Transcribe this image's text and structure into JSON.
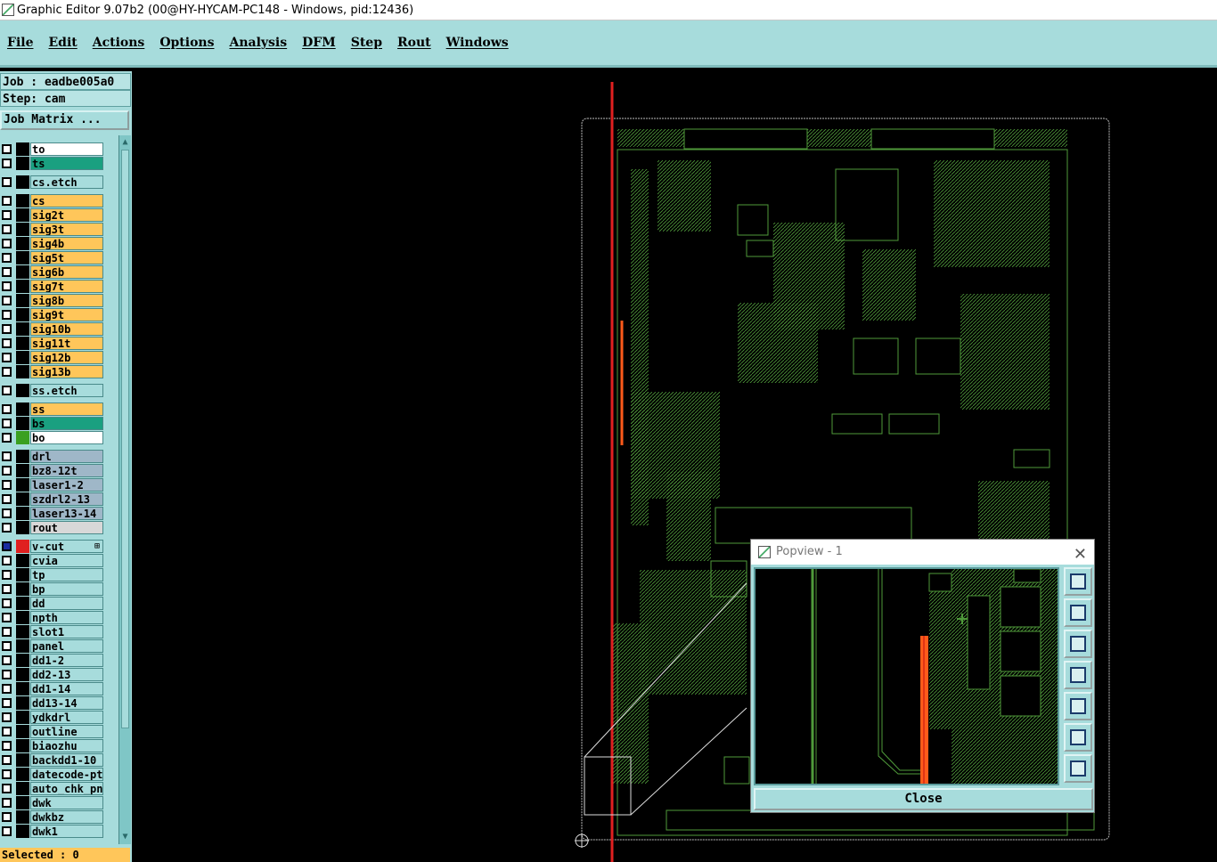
{
  "window": {
    "title": "Graphic Editor 9.07b2 (00@HY-HYCAM-PC148 - Windows, pid:12436)"
  },
  "menu": [
    "File",
    "Edit",
    "Actions",
    "Options",
    "Analysis",
    "DFM",
    "Step",
    "Rout",
    "Windows"
  ],
  "job": {
    "label": "Job : eadbe005a0",
    "step": "Step: cam",
    "matrix_button": "Job Matrix ..."
  },
  "layers": [
    {
      "name": "to",
      "color": "#ffffff",
      "sw": "#000000"
    },
    {
      "name": "ts",
      "color": "#1aa080",
      "sw": "#000000"
    },
    {
      "name": "cs.etch",
      "color": "#a7dcdc",
      "sw": "#000000",
      "gap": true
    },
    {
      "name": "cs",
      "color": "#ffc65a",
      "sw": "#000000",
      "gap": true
    },
    {
      "name": "sig2t",
      "color": "#ffc65a",
      "sw": "#000000"
    },
    {
      "name": "sig3t",
      "color": "#ffc65a",
      "sw": "#000000"
    },
    {
      "name": "sig4b",
      "color": "#ffc65a",
      "sw": "#000000"
    },
    {
      "name": "sig5t",
      "color": "#ffc65a",
      "sw": "#000000"
    },
    {
      "name": "sig6b",
      "color": "#ffc65a",
      "sw": "#000000"
    },
    {
      "name": "sig7t",
      "color": "#ffc65a",
      "sw": "#000000"
    },
    {
      "name": "sig8b",
      "color": "#ffc65a",
      "sw": "#000000"
    },
    {
      "name": "sig9t",
      "color": "#ffc65a",
      "sw": "#000000"
    },
    {
      "name": "sig10b",
      "color": "#ffc65a",
      "sw": "#000000"
    },
    {
      "name": "sig11t",
      "color": "#ffc65a",
      "sw": "#000000"
    },
    {
      "name": "sig12b",
      "color": "#ffc65a",
      "sw": "#000000"
    },
    {
      "name": "sig13b",
      "color": "#ffc65a",
      "sw": "#000000"
    },
    {
      "name": "ss.etch",
      "color": "#a7dcdc",
      "sw": "#000000",
      "gap": true
    },
    {
      "name": "ss",
      "color": "#ffc65a",
      "sw": "#000000",
      "gap": true
    },
    {
      "name": "bs",
      "color": "#1aa080",
      "sw": "#000000"
    },
    {
      "name": "bo",
      "color": "#ffffff",
      "sw": "#3aa020"
    },
    {
      "name": "drl",
      "color": "#9fb7c8",
      "sw": "#000000",
      "gap": true
    },
    {
      "name": "bz8-12t",
      "color": "#9fb7c8",
      "sw": "#000000"
    },
    {
      "name": "laser1-2",
      "color": "#9fb7c8",
      "sw": "#000000"
    },
    {
      "name": "szdrl2-13",
      "color": "#9fb7c8",
      "sw": "#000000"
    },
    {
      "name": "laser13-14",
      "color": "#9fb7c8",
      "sw": "#000000"
    },
    {
      "name": "rout",
      "color": "#d8d8d8",
      "sw": "#000000"
    },
    {
      "name": "v-cut",
      "color": "#a7dcdc",
      "sw": "#e02020",
      "cb": "#1a2aa0",
      "gap": true,
      "mark": "⊞"
    },
    {
      "name": "cvia",
      "color": "#a7dcdc",
      "sw": "#000000"
    },
    {
      "name": "tp",
      "color": "#a7dcdc",
      "sw": "#000000"
    },
    {
      "name": "bp",
      "color": "#a7dcdc",
      "sw": "#000000"
    },
    {
      "name": "dd",
      "color": "#a7dcdc",
      "sw": "#000000"
    },
    {
      "name": "npth",
      "color": "#a7dcdc",
      "sw": "#000000"
    },
    {
      "name": "slot1",
      "color": "#a7dcdc",
      "sw": "#000000"
    },
    {
      "name": "panel",
      "color": "#a7dcdc",
      "sw": "#000000"
    },
    {
      "name": "dd1-2",
      "color": "#a7dcdc",
      "sw": "#000000"
    },
    {
      "name": "dd2-13",
      "color": "#a7dcdc",
      "sw": "#000000"
    },
    {
      "name": "dd1-14",
      "color": "#a7dcdc",
      "sw": "#000000"
    },
    {
      "name": "dd13-14",
      "color": "#a7dcdc",
      "sw": "#000000"
    },
    {
      "name": "ydkdrl",
      "color": "#a7dcdc",
      "sw": "#000000"
    },
    {
      "name": "outline",
      "color": "#a7dcdc",
      "sw": "#000000"
    },
    {
      "name": "biaozhu",
      "color": "#a7dcdc",
      "sw": "#000000"
    },
    {
      "name": "backdd1-10",
      "color": "#a7dcdc",
      "sw": "#000000"
    },
    {
      "name": "datecode-pt",
      "color": "#a7dcdc",
      "sw": "#000000"
    },
    {
      "name": "auto_chk_pn",
      "color": "#a7dcdc",
      "sw": "#000000"
    },
    {
      "name": "dwk",
      "color": "#a7dcdc",
      "sw": "#000000"
    },
    {
      "name": "dwkbz",
      "color": "#a7dcdc",
      "sw": "#000000"
    },
    {
      "name": "dwk1",
      "color": "#a7dcdc",
      "sw": "#000000"
    }
  ],
  "status": {
    "selected": "Selected : 0"
  },
  "popview": {
    "title": "Popview - 1",
    "close_label": "Close"
  },
  "colors": {
    "panel": "#a7dcdc",
    "trace": "#4f9a3a",
    "highlight": "#ffc65a",
    "marker": "#e02020"
  }
}
